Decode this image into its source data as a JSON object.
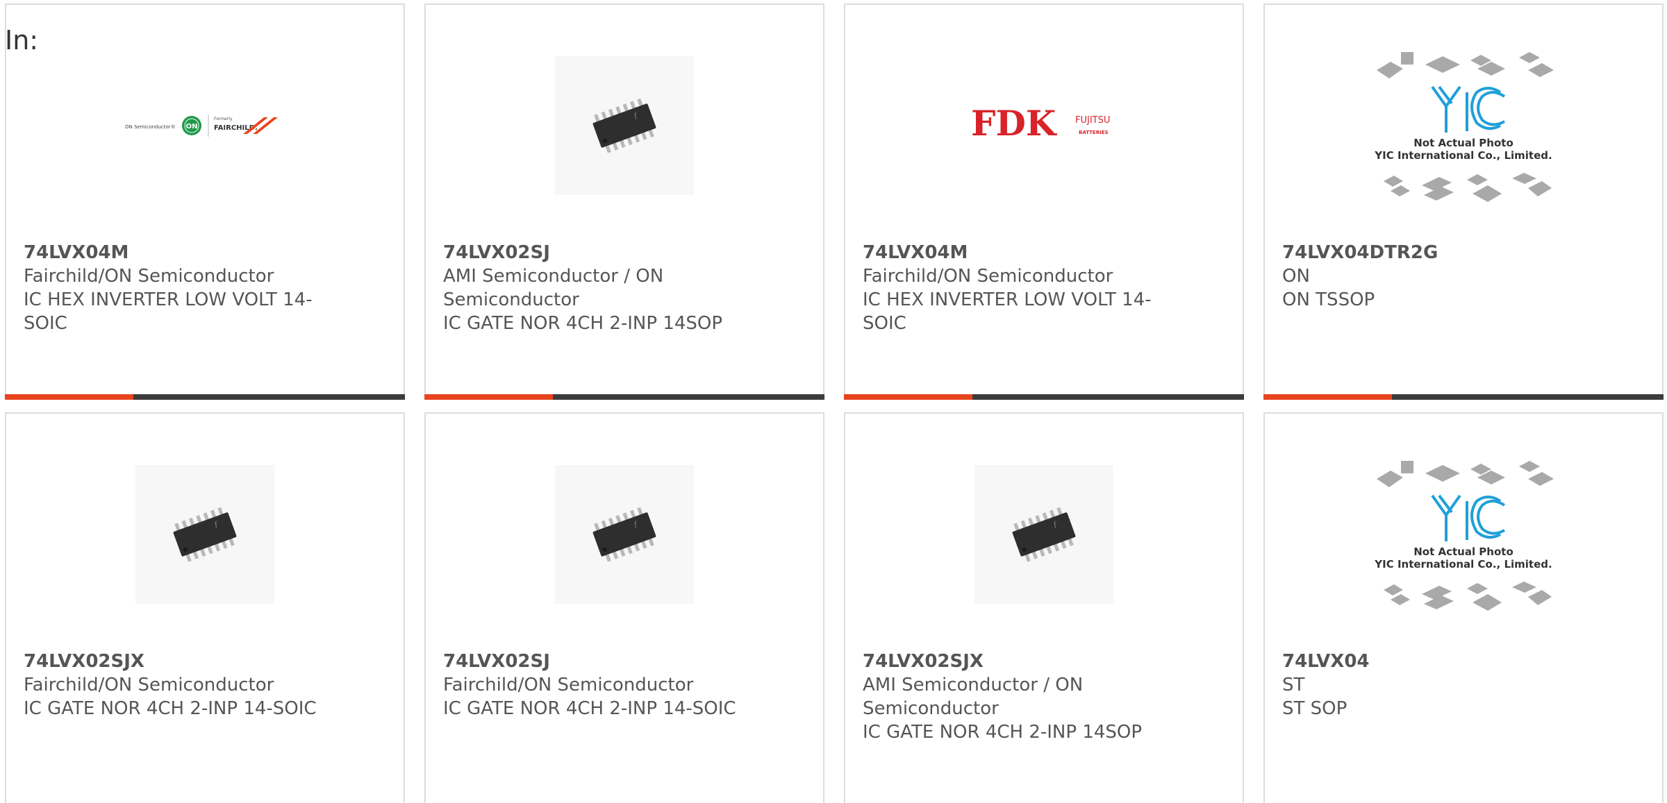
{
  "filter_label": "In:",
  "colors": {
    "accent": "#e8441e",
    "bar": "#3c3c3c",
    "border": "#dddddd",
    "text": "#555555"
  },
  "cards": [
    {
      "image": "fairchild-on-logo",
      "logo_text": {
        "left": "ON Semiconductor®",
        "on": "ON",
        "formerly": "Formerly",
        "brand": "FAIRCHILD."
      },
      "part_number": "74LVX04M",
      "manufacturer": "Fairchild/ON Semiconductor",
      "description": "IC HEX INVERTER LOW VOLT 14-SOIC"
    },
    {
      "image": "soic-chip-photo",
      "part_number": "74LVX02SJ",
      "manufacturer": "AMI Semiconductor / ON Semiconductor",
      "description": "IC GATE NOR 4CH 2-INP 14SOP"
    },
    {
      "image": "fdk-fujitsu-logo",
      "logo_text": {
        "main": "FDK",
        "sub": "FUJITSU",
        "sub2": "BATTERIES"
      },
      "part_number": "74LVX04M",
      "manufacturer": "Fairchild/ON Semiconductor",
      "description": "IC HEX INVERTER LOW VOLT 14-SOIC"
    },
    {
      "image": "yic-placeholder",
      "placeholder_text": {
        "brand": "YIC",
        "line1": "Not Actual Photo",
        "line2": "YIC International Co., Limited."
      },
      "part_number": "74LVX04DTR2G",
      "manufacturer": "ON",
      "description": "ON TSSOP"
    },
    {
      "image": "soic-chip-photo",
      "part_number": "74LVX02SJX",
      "manufacturer": "Fairchild/ON Semiconductor",
      "description": "IC GATE NOR 4CH 2-INP 14-SOIC"
    },
    {
      "image": "soic-chip-photo",
      "part_number": "74LVX02SJ",
      "manufacturer": "Fairchild/ON Semiconductor",
      "description": "IC GATE NOR 4CH 2-INP 14-SOIC"
    },
    {
      "image": "soic-chip-photo",
      "part_number": "74LVX02SJX",
      "manufacturer": "AMI Semiconductor / ON Semiconductor",
      "description": "IC GATE NOR 4CH 2-INP 14SOP"
    },
    {
      "image": "yic-placeholder",
      "placeholder_text": {
        "brand": "YIC",
        "line1": "Not Actual Photo",
        "line2": "YIC International Co., Limited."
      },
      "part_number": "74LVX04",
      "manufacturer": "ST",
      "description": "ST SOP"
    }
  ]
}
